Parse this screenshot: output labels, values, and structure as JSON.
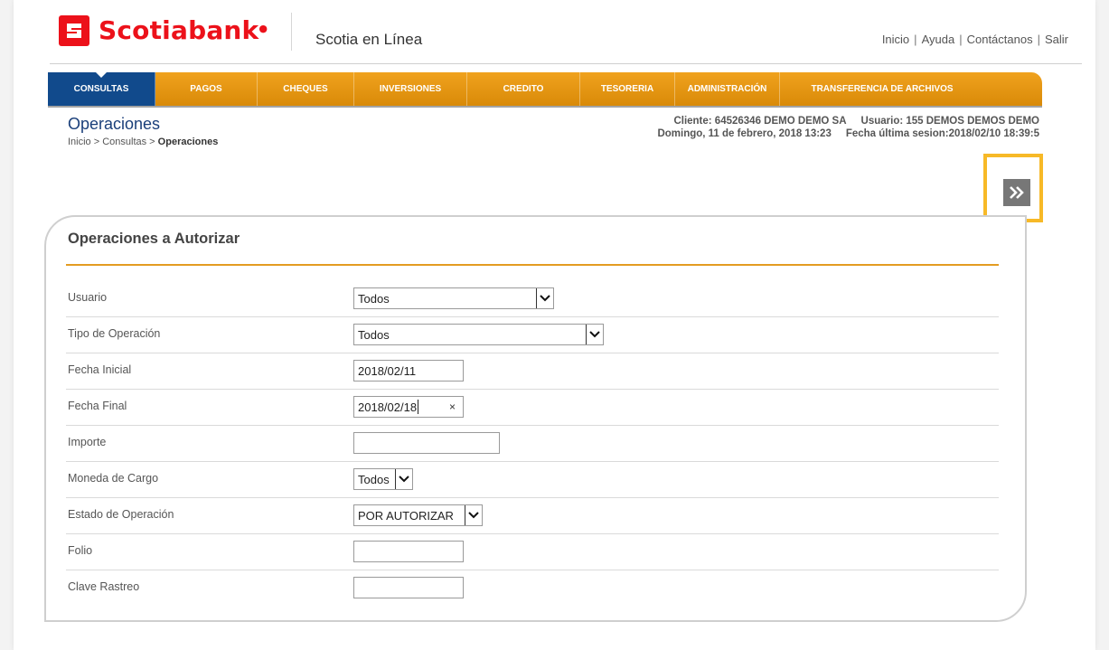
{
  "brand": {
    "logo_text": "Scotiabank",
    "app_name": "Scotia en Línea",
    "color": "#ec111a"
  },
  "top_links": [
    "Inicio",
    "Ayuda",
    "Contáctanos",
    "Salir"
  ],
  "nav": {
    "items": [
      "CONSULTAS",
      "PAGOS",
      "CHEQUES",
      "INVERSIONES",
      "CREDITO",
      "TESORERIA",
      "ADMINISTRACIÓN",
      "TRANSFERENCIA DE ARCHIVOS"
    ],
    "active": "CONSULTAS",
    "colors": {
      "bar": "#e69413",
      "active": "#114a8c"
    }
  },
  "page": {
    "title": "Operaciones",
    "breadcrumb": {
      "prefix": "Inicio > Consultas > ",
      "current": "Operaciones"
    }
  },
  "session": {
    "cliente": "Cliente: 64526346 DEMO DEMO SA",
    "usuario": "Usuario: 155 DEMOS DEMOS DEMO",
    "fecha": "Domingo, 11 de febrero, 2018 13:23",
    "ultima_sesion": "Fecha última sesion:2018/02/10 18:39:5"
  },
  "next_button": {
    "icon": "double-chevron-right-icon"
  },
  "form": {
    "title": "Operaciones a Autorizar",
    "fields": {
      "usuario": {
        "label": "Usuario",
        "value": "Todos"
      },
      "tipo_operacion": {
        "label": "Tipo de Operación",
        "value": "Todos"
      },
      "fecha_inicial": {
        "label": "Fecha Inicial",
        "value": "2018/02/11"
      },
      "fecha_final": {
        "label": "Fecha Final",
        "value": "2018/02/18",
        "clear": "×"
      },
      "importe": {
        "label": "Importe",
        "value": ""
      },
      "moneda_cargo": {
        "label": "Moneda de Cargo",
        "value": "Todos"
      },
      "estado_operacion": {
        "label": "Estado de Operación",
        "value": "POR AUTORIZAR"
      },
      "folio": {
        "label": "Folio",
        "value": ""
      },
      "clave_rastreo": {
        "label": "Clave Rastreo",
        "value": ""
      }
    }
  }
}
